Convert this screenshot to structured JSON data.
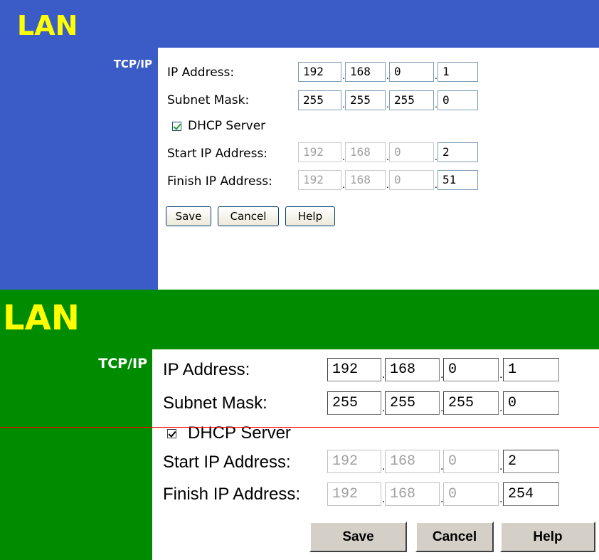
{
  "top": {
    "title": "LAN",
    "section": "TCP/IP",
    "ip_label": "IP Address:",
    "ip": [
      "192",
      "168",
      "0",
      "1"
    ],
    "mask_label": "Subnet Mask:",
    "mask": [
      "255",
      "255",
      "255",
      "0"
    ],
    "dhcp_label": "DHCP Server",
    "dhcp_checked": true,
    "start_label": "Start IP Address:",
    "start": [
      "192",
      "168",
      "0",
      "2"
    ],
    "finish_label": "Finish IP Address:",
    "finish": [
      "192",
      "168",
      "0",
      "51"
    ],
    "save": "Save",
    "cancel": "Cancel",
    "help": "Help",
    "colors": {
      "bar": "#3b5cc6",
      "title": "#ffff00",
      "check": "#21a121"
    }
  },
  "bottom": {
    "title": "LAN",
    "section": "TCP/IP",
    "ip_label": "IP Address:",
    "ip": [
      "192",
      "168",
      "0",
      "1"
    ],
    "mask_label": "Subnet Mask:",
    "mask": [
      "255",
      "255",
      "255",
      "0"
    ],
    "dhcp_label": "DHCP Server",
    "dhcp_checked": true,
    "start_label": "Start IP Address:",
    "start": [
      "192",
      "168",
      "0",
      "2"
    ],
    "finish_label": "Finish IP Address:",
    "finish": [
      "192",
      "168",
      "0",
      "254"
    ],
    "save": "Save",
    "cancel": "Cancel",
    "help": "Help",
    "colors": {
      "bar": "#008c00",
      "title": "#ffff00",
      "divider": "#ff0000"
    }
  }
}
